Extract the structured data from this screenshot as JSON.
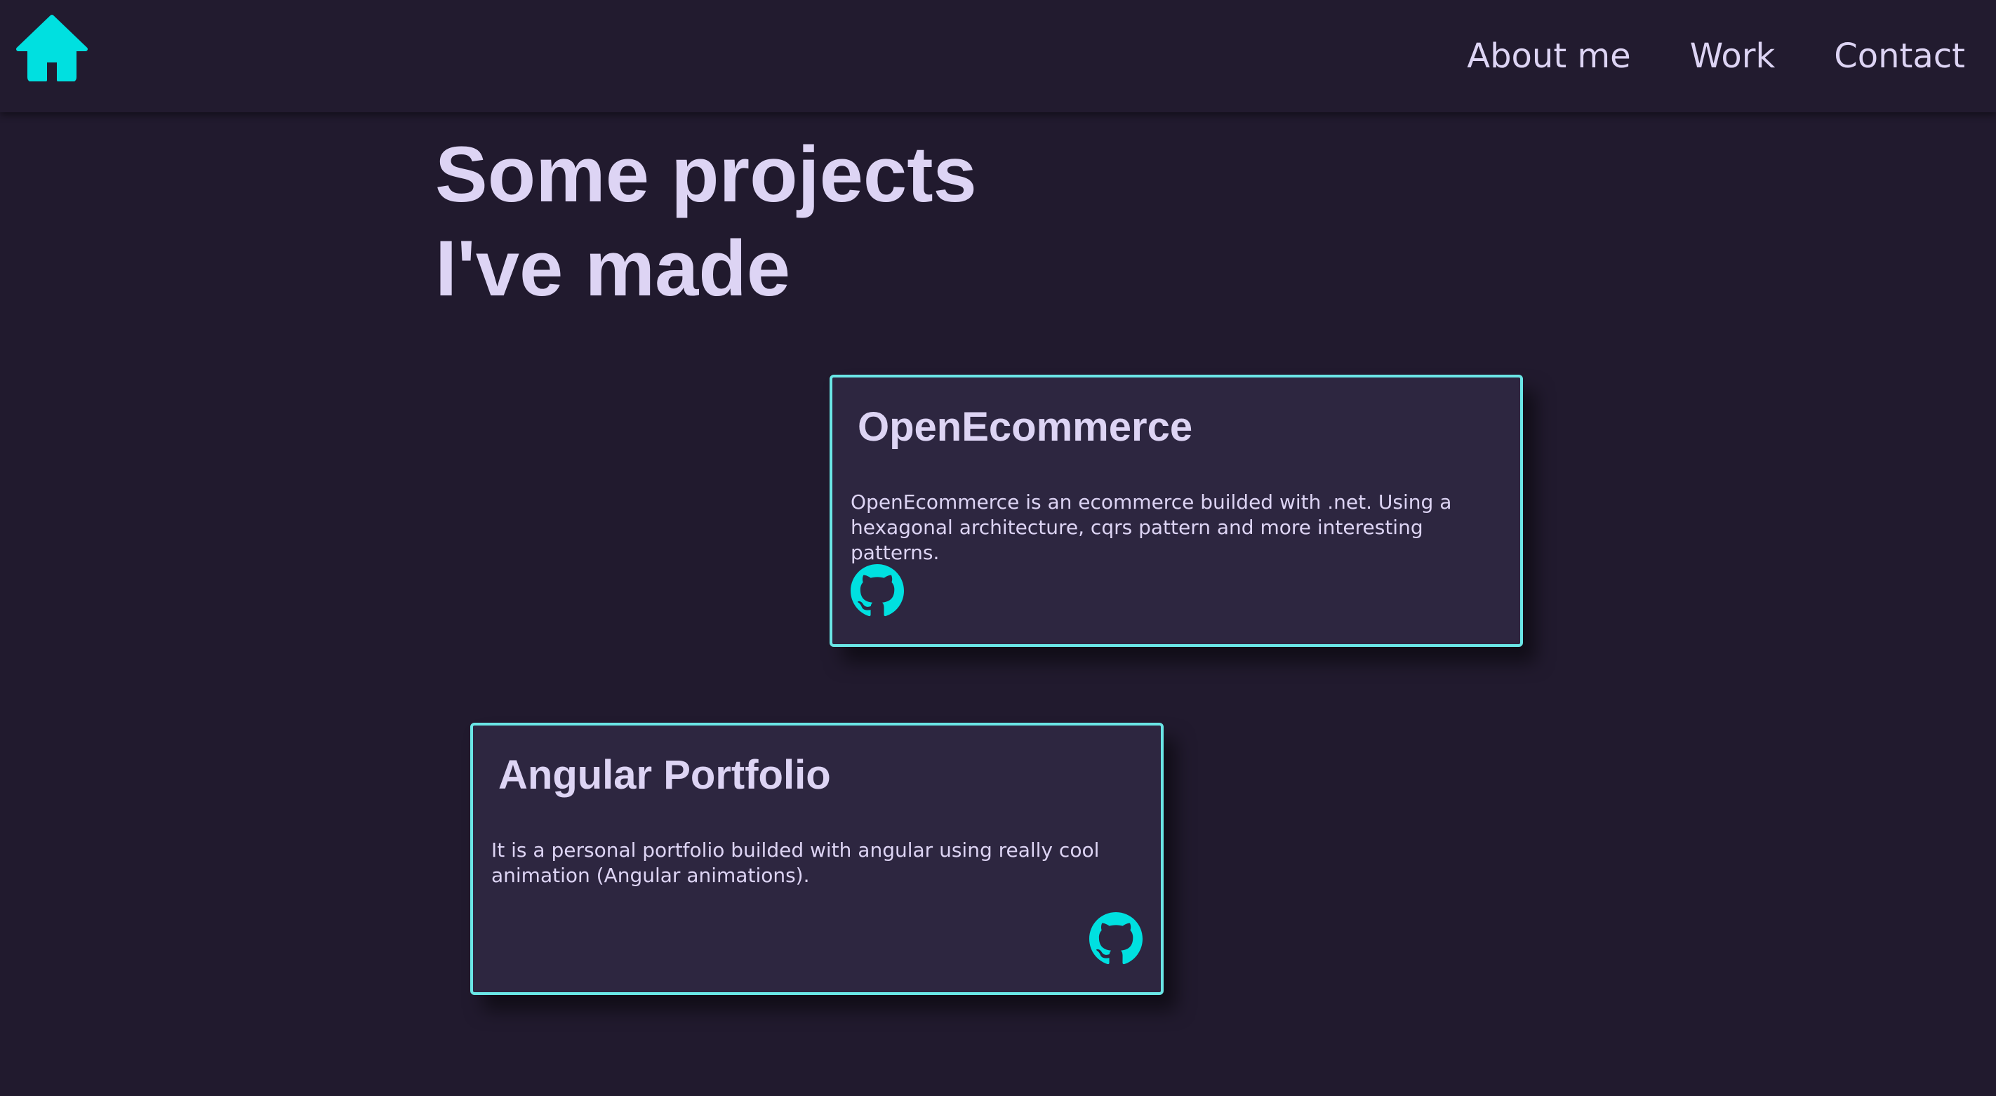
{
  "colors": {
    "background": "#211a2e",
    "navbar": "#221b2f",
    "card_background": "#2d2640",
    "card_border": "#6ae6e6",
    "accent": "#00e0e0",
    "text": "#ddd4f4"
  },
  "nav": {
    "home_icon": "home-icon",
    "links": [
      {
        "label": "About me"
      },
      {
        "label": "Work"
      },
      {
        "label": "Contact"
      }
    ]
  },
  "main": {
    "title_line_1": "Some projects",
    "title_line_2": "I've made",
    "projects": [
      {
        "title": "OpenEcommerce",
        "description": "OpenEcommerce is an ecommerce builded with .net. Using a hexagonal architecture, cqrs pattern and more interesting patterns.",
        "icon": "github-icon"
      },
      {
        "title": "Angular Portfolio",
        "description": "It is a personal portfolio builded with angular using really cool animation (Angular animations).",
        "icon": "github-icon"
      }
    ]
  }
}
